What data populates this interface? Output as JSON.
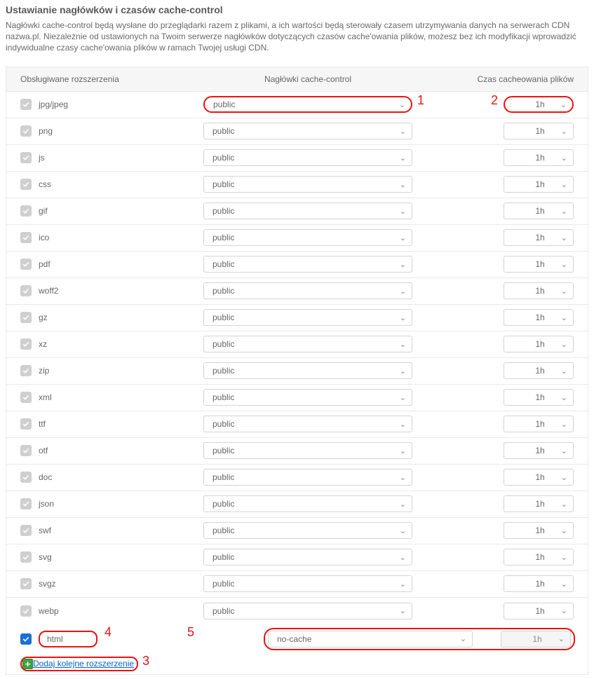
{
  "title": "Ustawianie nagłówków i czasów cache-control",
  "description": "Nagłówki cache-control będą wysłane do przeglądarki razem z plikami, a ich wartości będą sterowały czasem utrzymywania danych na serwerach CDN nazwa.pl. Niezależnie od ustawionych na Twoim serwerze nagłówków dotyczących czasów cache'owania plików, możesz bez ich modyfikacji wprowadzić indywidualne czasy cache'owania plików w ramach Twojej usługi CDN.",
  "columns": {
    "ext": "Obsługiwane rozszerzenia",
    "header": "Nagłówki cache-control",
    "time": "Czas cacheowania plików"
  },
  "rows": [
    {
      "ext": "jpg/jpeg",
      "header": "public",
      "time": "1h",
      "highlight": true
    },
    {
      "ext": "png",
      "header": "public",
      "time": "1h"
    },
    {
      "ext": "js",
      "header": "public",
      "time": "1h"
    },
    {
      "ext": "css",
      "header": "public",
      "time": "1h"
    },
    {
      "ext": "gif",
      "header": "public",
      "time": "1h"
    },
    {
      "ext": "ico",
      "header": "public",
      "time": "1h"
    },
    {
      "ext": "pdf",
      "header": "public",
      "time": "1h"
    },
    {
      "ext": "woff2",
      "header": "public",
      "time": "1h"
    },
    {
      "ext": "gz",
      "header": "public",
      "time": "1h"
    },
    {
      "ext": "xz",
      "header": "public",
      "time": "1h"
    },
    {
      "ext": "zip",
      "header": "public",
      "time": "1h"
    },
    {
      "ext": "xml",
      "header": "public",
      "time": "1h"
    },
    {
      "ext": "ttf",
      "header": "public",
      "time": "1h"
    },
    {
      "ext": "otf",
      "header": "public",
      "time": "1h"
    },
    {
      "ext": "doc",
      "header": "public",
      "time": "1h"
    },
    {
      "ext": "json",
      "header": "public",
      "time": "1h"
    },
    {
      "ext": "swf",
      "header": "public",
      "time": "1h"
    },
    {
      "ext": "svg",
      "header": "public",
      "time": "1h"
    },
    {
      "ext": "svgz",
      "header": "public",
      "time": "1h"
    },
    {
      "ext": "webp",
      "header": "public",
      "time": "1h"
    }
  ],
  "custom_row": {
    "ext_value": "html",
    "header": "no-cache",
    "time": "1h"
  },
  "add_link": "Dodaj kolejne rozszerzenie",
  "annotations": {
    "a1": "1",
    "a2": "2",
    "a3": "3",
    "a4": "4",
    "a5": "5"
  }
}
